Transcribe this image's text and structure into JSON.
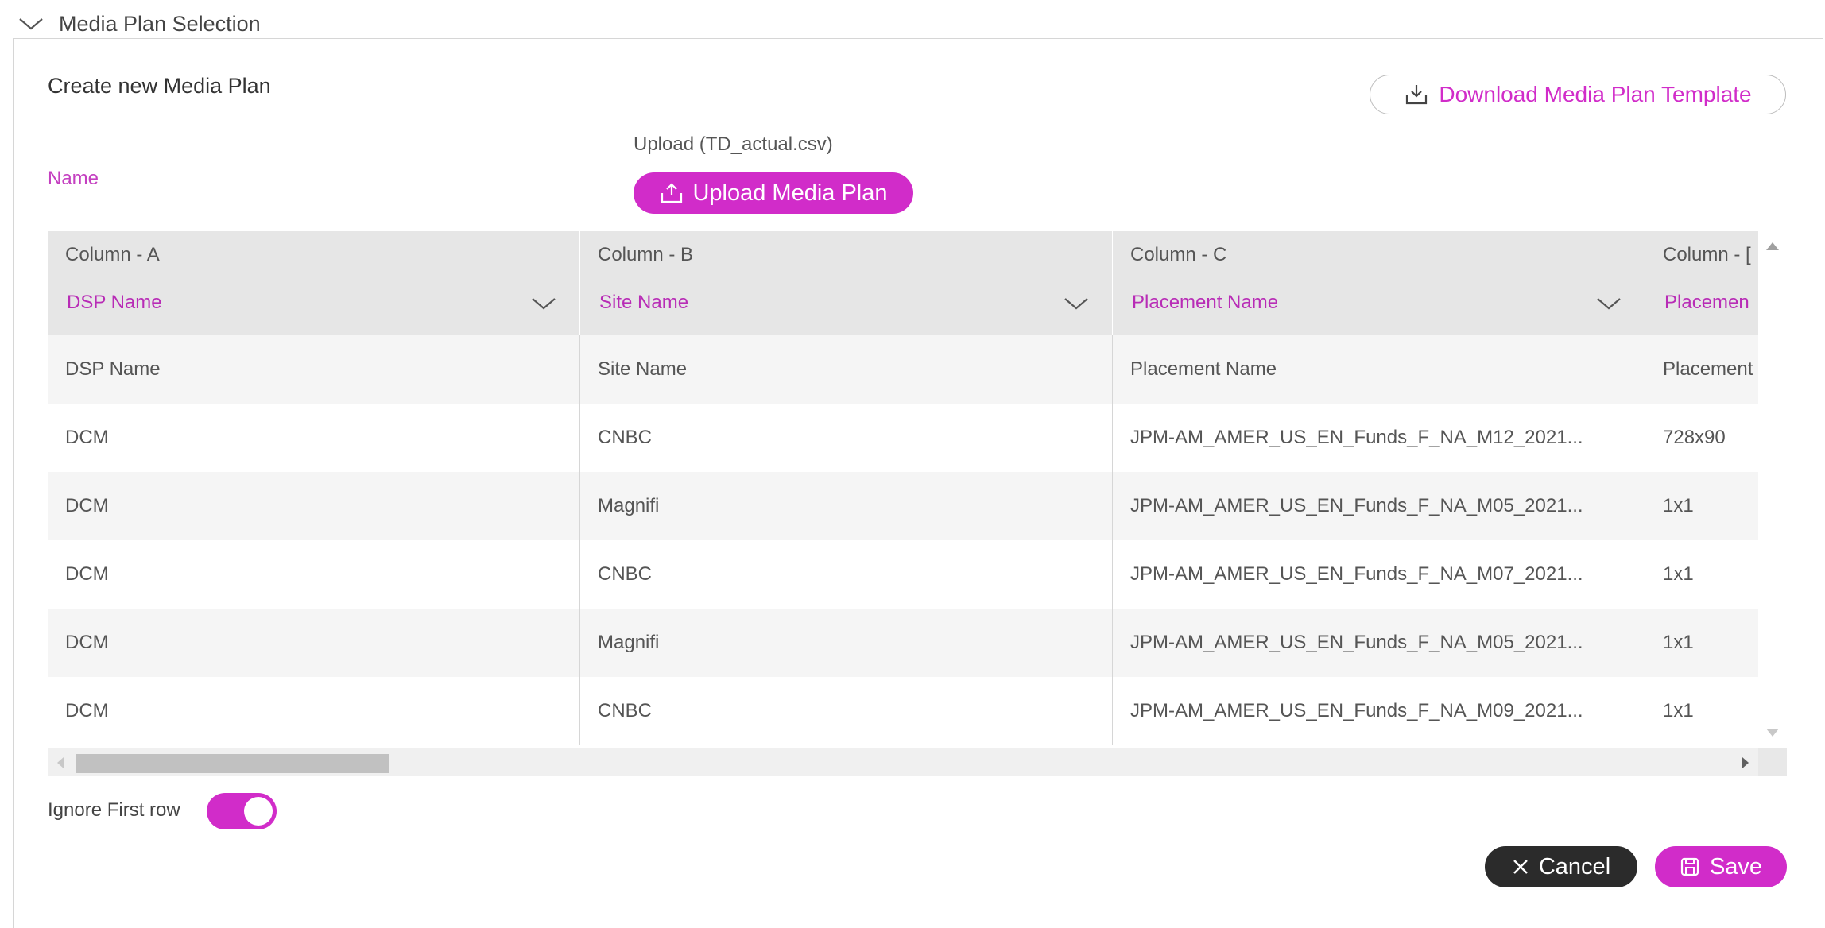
{
  "section": {
    "title": "Media Plan Selection"
  },
  "panel": {
    "title": "Create new Media Plan"
  },
  "download": {
    "label": "Download Media Plan Template"
  },
  "name_field": {
    "placeholder": "Name",
    "value": ""
  },
  "upload": {
    "label": "Upload (TD_actual.csv)",
    "button_label": "Upload Media Plan"
  },
  "grid": {
    "columns": [
      {
        "letter": "Column - A",
        "mapping": "DSP Name"
      },
      {
        "letter": "Column - B",
        "mapping": "Site Name"
      },
      {
        "letter": "Column - C",
        "mapping": "Placement Name"
      },
      {
        "letter": "Column - [",
        "mapping": "Placemen"
      }
    ],
    "rows": [
      [
        "DSP Name",
        "Site Name",
        "Placement Name",
        "Placement"
      ],
      [
        "DCM",
        "CNBC",
        "JPM-AM_AMER_US_EN_Funds_F_NA_M12_2021...",
        "728x90"
      ],
      [
        "DCM",
        "Magnifi",
        "JPM-AM_AMER_US_EN_Funds_F_NA_M05_2021...",
        "1x1"
      ],
      [
        "DCM",
        "CNBC",
        "JPM-AM_AMER_US_EN_Funds_F_NA_M07_2021...",
        "1x1"
      ],
      [
        "DCM",
        "Magnifi",
        "JPM-AM_AMER_US_EN_Funds_F_NA_M05_2021...",
        "1x1"
      ],
      [
        "DCM",
        "CNBC",
        "JPM-AM_AMER_US_EN_Funds_F_NA_M09_2021...",
        "1x1"
      ]
    ]
  },
  "toggle": {
    "label": "Ignore First row",
    "on": true
  },
  "actions": {
    "cancel_label": "Cancel",
    "save_label": "Save"
  },
  "colors": {
    "accent": "#d12cc9",
    "dark": "#2b2b2b",
    "header_bg": "#e6e6e6"
  },
  "icons": {
    "section": "chevron-down-icon",
    "download": "download-icon",
    "upload": "upload-icon",
    "cancel": "close-icon",
    "save": "save-icon"
  }
}
